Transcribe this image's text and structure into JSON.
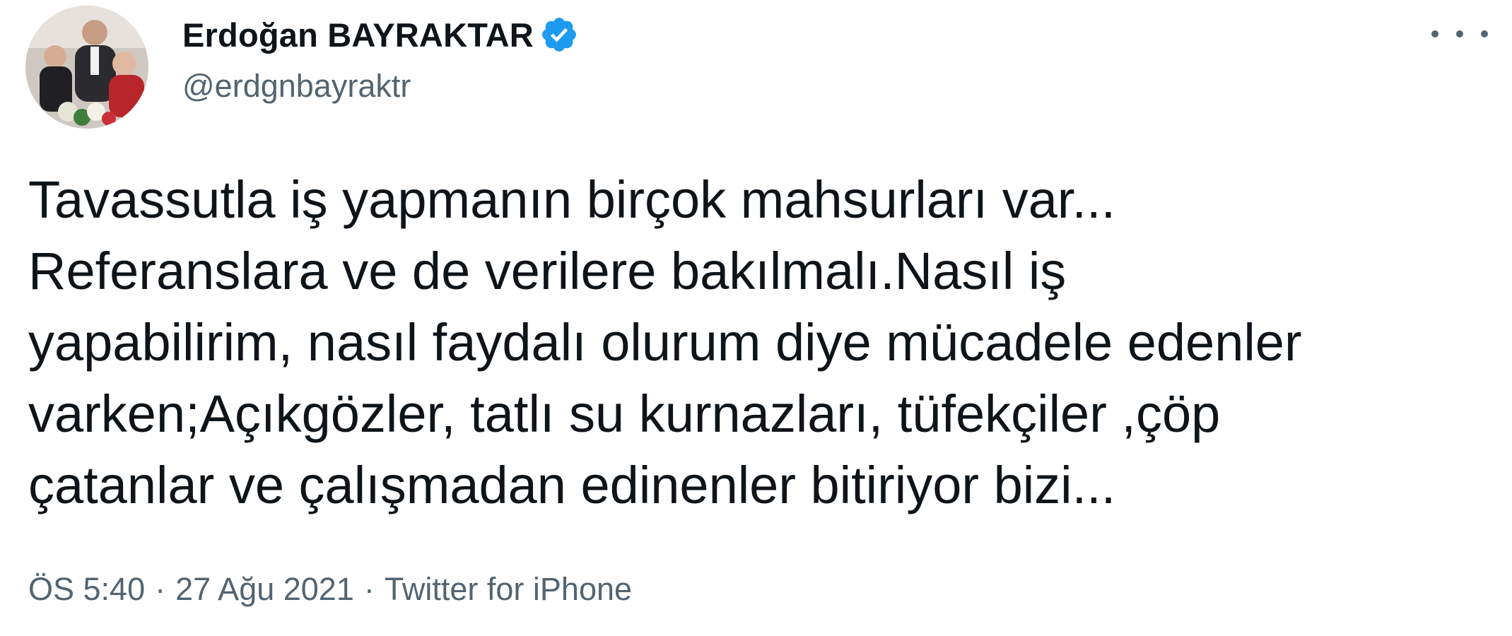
{
  "author": {
    "display_name": "Erdoğan BAYRAKTAR",
    "handle": "@erdgnbayraktr",
    "verified": true,
    "avatar_icon": "profile-photo"
  },
  "tweet": {
    "text": "Tavassutla iş yapmanın birçok mahsurları var...\nReferanslara ve de verilere bakılmalı.Nasıl iş\nyapabilirim, nasıl faydalı olurum diye mücadele edenler\nvarken;Açıkgözler, tatlı su kurnazları, tüfekçiler ,çöp\nçatanlar ve çalışmadan edinenler bitiriyor bizi...",
    "time": "ÖS 5:40",
    "date": "27 Ağu 2021",
    "separator": "·",
    "source": "Twitter for iPhone"
  },
  "colors": {
    "primary_text": "#0f1419",
    "secondary_text": "#536471",
    "verified_badge": "#1d9bf0"
  },
  "icons": {
    "more": "more-horizontal-icon",
    "verified": "verified-badge-icon"
  }
}
